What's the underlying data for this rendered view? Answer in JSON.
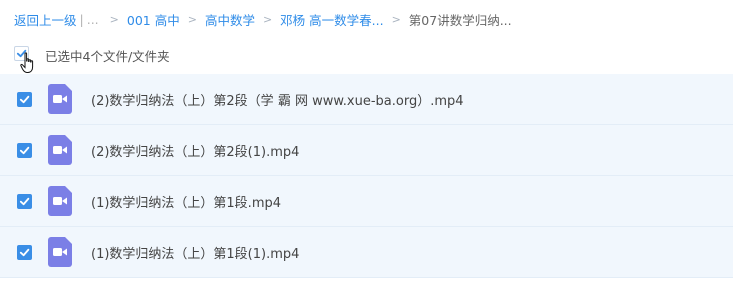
{
  "breadcrumb": {
    "back_label": "返回上一级",
    "separator_bar": "|",
    "ellipsis": "...",
    "chevron": ">",
    "items": [
      "001 高中",
      "高中数学",
      "邓杨 高一数学春...",
      "第07讲数学归纳..."
    ]
  },
  "selection": {
    "text": "已选中4个文件/文件夹"
  },
  "files": [
    {
      "name": "(2)数学归纳法（上）第2段（学 霸 网 www.xue-ba.org）.mp4",
      "icon": "video-file-icon",
      "checked": true
    },
    {
      "name": "(2)数学归纳法（上）第2段(1).mp4",
      "icon": "video-file-icon",
      "checked": true
    },
    {
      "name": "(1)数学归纳法（上）第1段.mp4",
      "icon": "video-file-icon",
      "checked": true
    },
    {
      "name": "(1)数学归纳法（上）第1段(1).mp4",
      "icon": "video-file-icon",
      "checked": true
    }
  ],
  "colors": {
    "link": "#2f8ce8",
    "checkbox": "#3a8ee6",
    "row_selected_bg": "#f1f7fd",
    "video_icon": "#7b7fe6"
  }
}
